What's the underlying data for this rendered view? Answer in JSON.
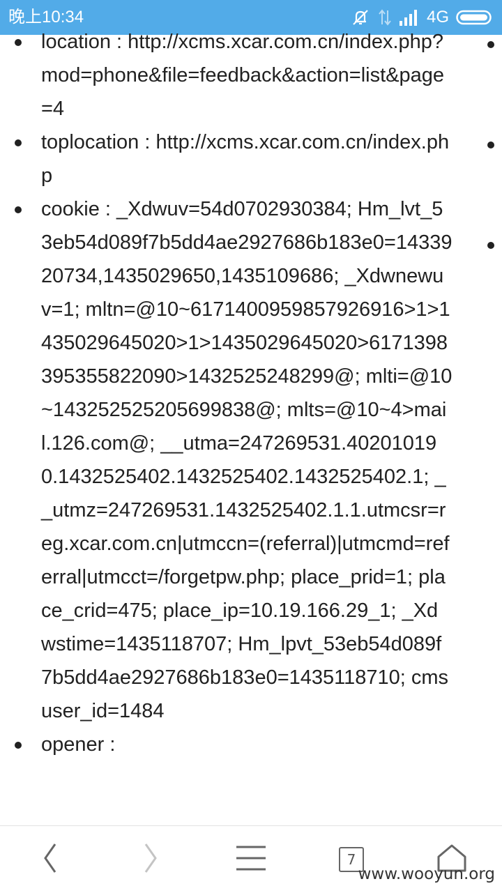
{
  "status_bar": {
    "time": "晚上10:34",
    "network": "4G"
  },
  "content": {
    "entries": [
      {
        "text": "location : http://xcms.xcar.com.cn/index.php?mod=phone&file=feedback&action=list&page=4"
      },
      {
        "text": "toplocation : http://xcms.xcar.com.cn/index.php"
      },
      {
        "text": "cookie : _Xdwuv=54d0702930384; Hm_lvt_53eb54d089f7b5dd4ae2927686b183e0=1433920734,1435029650,1435109686; _Xdwnewuv=1; mltn=@10~6171400959857926916>1>1435029645020>1>1435029645020>6171398395355822090>1432525248299@; mlti=@10~143252525205699838@; mlts=@10~4>mail.126.com@; __utma=247269531.402010190.1432525402.1432525402.1432525402.1; __utmz=247269531.1432525402.1.1.utmcsr=reg.xcar.com.cn|utmccn=(referral)|utmcmd=referral|utmcct=/forgetpw.php; place_prid=1; place_crid=475; place_ip=10.19.166.29_1; _Xdwstime=1435118707; Hm_lpvt_53eb54d089f7b5dd4ae2927686b183e0=1435118710; cmsuser_id=1484"
      },
      {
        "text": "opener :"
      }
    ]
  },
  "bottom_nav": {
    "tab_count": "7",
    "icons": [
      "back-icon",
      "forward-icon",
      "menu-icon",
      "tabs-icon",
      "home-icon"
    ]
  },
  "watermark": "www.wooyun.org"
}
